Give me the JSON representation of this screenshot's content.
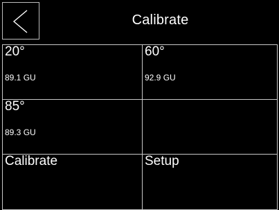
{
  "header": {
    "title": "Calibrate",
    "back_icon": "chevron-left-icon"
  },
  "readings": [
    {
      "angle": "20°",
      "value": "89.1 GU"
    },
    {
      "angle": "60°",
      "value": "92.9 GU"
    },
    {
      "angle": "85°",
      "value": "89.3 GU"
    }
  ],
  "actions": {
    "calibrate_label": "Calibrate",
    "setup_label": "Setup"
  },
  "colors": {
    "background": "#000000",
    "text": "#ffffff",
    "border": "#c9c9c9"
  }
}
